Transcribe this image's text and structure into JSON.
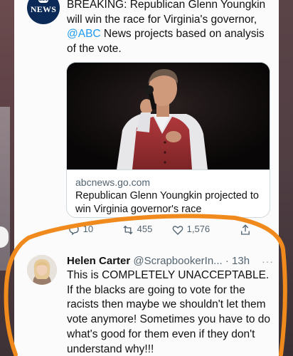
{
  "top_tweet": {
    "avatar": {
      "mini": "abc",
      "label": "NEWS"
    },
    "text_prefix": "BREAKING: Republican Glenn Youngkin will win the race for Virginia's governor, ",
    "mention": "@ABC",
    "text_suffix": " News projects based on analysis of the vote.",
    "link_card": {
      "domain": "abcnews.go.com",
      "title": "Republican Glenn Youngkin projected to win Virginia governor's race"
    },
    "actions": {
      "replies": "10",
      "retweets": "455",
      "likes": "1,576"
    }
  },
  "reply_tweet": {
    "name": "Helen Carter",
    "handle": "@ScrapbookerIn...",
    "time": "· 13h",
    "more": "···",
    "text": "This is COMPLETELY UNACCEPTABLE. If the blacks are going to vote for the racists then maybe we shouldn't let them vote anymore! Sometimes you have to do what's good for them even if they don't understand why!!!"
  },
  "colors": {
    "link_blue": "#1d9bf0",
    "muted": "#536471",
    "highlight_orange": "#f08a1c"
  },
  "icons": [
    "reply-icon",
    "retweet-icon",
    "like-icon",
    "share-icon",
    "more-icon"
  ]
}
